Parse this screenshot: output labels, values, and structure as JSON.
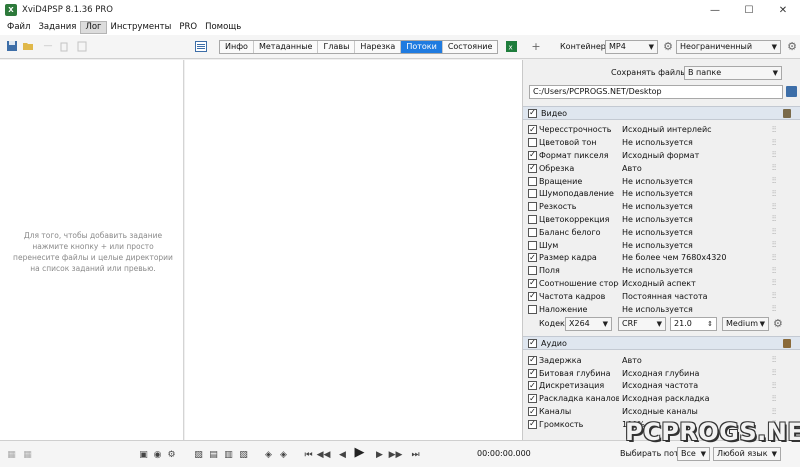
{
  "window": {
    "title": "XviD4PSP 8.1.36 PRO",
    "controls": [
      "—",
      "☐",
      "✕"
    ]
  },
  "menu": [
    {
      "label": "Файл",
      "active": false
    },
    {
      "label": "Задания",
      "active": false
    },
    {
      "label": "Лог",
      "active": true
    },
    {
      "label": "Инструменты",
      "active": false
    },
    {
      "label": "PRO",
      "active": false
    },
    {
      "label": "Помощь",
      "active": false
    }
  ],
  "tabs": [
    {
      "label": "Инфо",
      "active": false
    },
    {
      "label": "Метаданные",
      "active": false
    },
    {
      "label": "Главы",
      "active": false
    },
    {
      "label": "Нарезка",
      "active": false
    },
    {
      "label": "Потоки",
      "active": true
    },
    {
      "label": "Состояние",
      "active": false
    }
  ],
  "toolbar": {
    "add_symbol": "+",
    "container_label": "Контейнер:",
    "container_value": "MP4",
    "limit_value": "Неограниченный"
  },
  "left_pane": {
    "hint": "Для того, чтобы добавить задание нажмите кнопку + или просто перенесите файлы и целые директории на список заданий или превью."
  },
  "right_pane": {
    "save_label": "Сохранять файлы:",
    "save_mode": "В папке",
    "output_path": "C:/Users/PCPROGS.NET/Desktop",
    "video": {
      "title": "Видео",
      "checked": true,
      "filters": [
        {
          "name": "Чересстрочность",
          "value": "Исходный интерлейс",
          "checked": true
        },
        {
          "name": "Цветовой тон",
          "value": "Не используется",
          "checked": false
        },
        {
          "name": "Формат пикселя",
          "value": "Исходный формат",
          "checked": true
        },
        {
          "name": "Обрезка",
          "value": "Авто",
          "checked": true
        },
        {
          "name": "Вращение",
          "value": "Не используется",
          "checked": false
        },
        {
          "name": "Шумоподавление",
          "value": "Не используется",
          "checked": false
        },
        {
          "name": "Резкость",
          "value": "Не используется",
          "checked": false
        },
        {
          "name": "Цветокоррекция",
          "value": "Не используется",
          "checked": false
        },
        {
          "name": "Баланс белого",
          "value": "Не используется",
          "checked": false
        },
        {
          "name": "Шум",
          "value": "Не используется",
          "checked": false
        },
        {
          "name": "Размер кадра",
          "value": "Не более чем 7680x4320",
          "checked": true
        },
        {
          "name": "Поля",
          "value": "Не используется",
          "checked": false
        },
        {
          "name": "Соотношение сторон",
          "value": "Исходный аспект",
          "checked": true
        },
        {
          "name": "Частота кадров",
          "value": "Постоянная частота",
          "checked": true
        },
        {
          "name": "Наложение",
          "value": "Не используется",
          "checked": false
        }
      ],
      "codec_label": "Кодек:",
      "codec": "X264",
      "mode": "CRF",
      "quality": "21.0",
      "preset": "Medium"
    },
    "audio": {
      "title": "Аудио",
      "checked": true,
      "filters": [
        {
          "name": "Задержка",
          "value": "Авто",
          "checked": true
        },
        {
          "name": "Битовая глубина",
          "value": "Исходная глубина",
          "checked": true
        },
        {
          "name": "Дискретизация",
          "value": "Исходная частота",
          "checked": true
        },
        {
          "name": "Раскладка каналов",
          "value": "Исходная раскладка",
          "checked": true
        },
        {
          "name": "Каналы",
          "value": "Исходные каналы",
          "checked": true
        },
        {
          "name": "Громкость",
          "value": "100%",
          "checked": true
        }
      ]
    }
  },
  "bottom": {
    "time": "00:00:00.000",
    "streams_label": "Выбирать потоки:",
    "streams_value": "Все",
    "language_value": "Любой язык"
  },
  "watermark": "PCPROGS.NET",
  "colors": {
    "accent": "#1f7be0",
    "section_bg": "#dfe6ef"
  }
}
